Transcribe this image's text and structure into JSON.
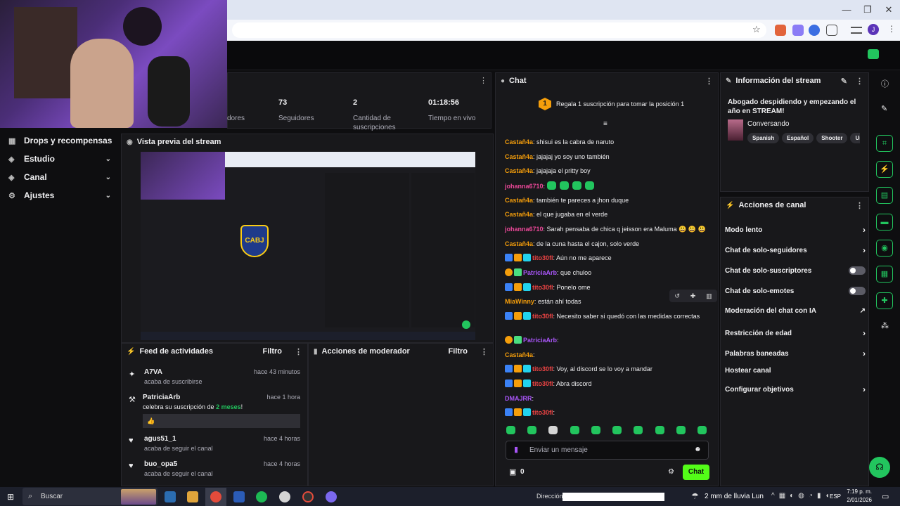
{
  "browser": {
    "window_controls": [
      "—",
      "❐",
      "✕"
    ],
    "profile_initial": "J"
  },
  "nav": {
    "items": [
      {
        "label": "Drops y recompensas",
        "icon": "gift-icon",
        "chevron": false
      },
      {
        "label": "Estudio",
        "icon": "studio-icon",
        "chevron": true
      },
      {
        "label": "Canal",
        "icon": "channel-icon",
        "chevron": true
      },
      {
        "label": "Ajustes",
        "icon": "gear-icon",
        "chevron": true
      }
    ]
  },
  "stats": [
    {
      "value": "",
      "label": "dores"
    },
    {
      "value": "73",
      "label": "Seguidores"
    },
    {
      "value": "2",
      "label": "Cantidad de suscripciones"
    },
    {
      "value": "01:18:56",
      "label": "Tiempo en vivo"
    }
  ],
  "preview": {
    "title": "Vista previa del stream",
    "logo_text": "CABJ"
  },
  "activity": {
    "title": "Feed de actividades",
    "filter": "Filtro",
    "items": [
      {
        "name": "A7VA",
        "sub": "acaba de suscribirse",
        "time": "hace 43 minutos",
        "icon": "sparkle-icon"
      },
      {
        "name": "PatriciaArb",
        "sub_prefix": "celebra su suscripción de ",
        "sub_bold": "2 meses",
        "sub_suffix": "!",
        "time": "hace 1 hora",
        "icon": "resub-icon",
        "message": "👍"
      },
      {
        "name": "agus51_1",
        "sub": "acaba de seguir el canal",
        "time": "hace 4 horas",
        "icon": "heart-icon"
      },
      {
        "name": "buo_opa5",
        "sub": "acaba de seguir el canal",
        "time": "hace 4 horas",
        "icon": "heart-icon"
      }
    ]
  },
  "moderator": {
    "title": "Acciones de moderador",
    "filter": "Filtro"
  },
  "chat": {
    "title": "Chat",
    "banner_rank": "1",
    "banner": "Regala 1 suscripción para tomar la posición 1",
    "messages": [
      {
        "user": "Castañ4a",
        "text": "shisui es la cabra de naruto",
        "color": "#f59e0b"
      },
      {
        "user": "Castañ4a",
        "text": "jajajaj yo soy uno también",
        "color": "#f59e0b"
      },
      {
        "user": "Castañ4a",
        "text": "jajajaja el pritty boy",
        "color": "#f59e0b"
      },
      {
        "user": "johanna6710",
        "text": "",
        "color": "#ec4899",
        "emotes": 4
      },
      {
        "user": "Castañ4a",
        "text": "también te pareces a jhon duque",
        "color": "#f59e0b"
      },
      {
        "user": "Castañ4a",
        "text": "el que jugaba en el verde",
        "color": "#f59e0b"
      },
      {
        "user": "johanna6710",
        "text": "Sarah pensaba de chica q jeisson era Maluma 😃 😃 😃",
        "color": "#ec4899"
      },
      {
        "user": "Castañ4a",
        "text": "de la cuna hasta el cajon, solo verde",
        "color": "#f59e0b"
      },
      {
        "user": "tito30fl",
        "text": "Aún no me aparece",
        "color": "#ef4444",
        "badges": 3
      },
      {
        "user": "PatriciaArb",
        "text": "que chuloo",
        "color": "#a855f7",
        "badges": 2
      },
      {
        "user": "tito30fl",
        "text": "Ponelo ome",
        "color": "#ef4444",
        "badges": 3
      },
      {
        "user": "MiaWinny",
        "text": "están ahí todas",
        "color": "#f59e0b"
      },
      {
        "user": "tito30fl",
        "text": "Necesito saber si quedó con las medidas correctas",
        "color": "#ef4444",
        "badges": 3
      },
      {
        "user": "PatriciaArb",
        "text": "",
        "color": "#a855f7",
        "badges": 2
      },
      {
        "user": "Castañ4a",
        "text": "",
        "color": "#f59e0b"
      },
      {
        "user": "tito30fl",
        "text": "Voy, al discord se lo voy a mandar",
        "color": "#ef4444",
        "badges": 3
      },
      {
        "user": "tito30fl",
        "text": "Abra discord",
        "color": "#ef4444",
        "badges": 3
      },
      {
        "user": "DMAJRR",
        "text": "",
        "color": "#a855f7"
      },
      {
        "user": "tito30fl",
        "text": "",
        "color": "#ef4444",
        "badges": 3
      }
    ],
    "input_placeholder": "Enviar un mensaje",
    "points": "0",
    "send_label": "Chat"
  },
  "stream_info": {
    "title": "Información del stream",
    "stream_title": "Abogado despidiendo y empezando el año en STREAM!",
    "category": "Conversando",
    "tags": [
      "Spanish",
      "Español",
      "Shooter",
      "Una"
    ]
  },
  "channel_actions": {
    "title": "Acciones de canal",
    "items": [
      {
        "label": "Modo lento",
        "control": "chevron"
      },
      {
        "label": "Chat de solo-seguidores",
        "control": "chevron"
      },
      {
        "label": "Chat de solo-suscriptores",
        "control": "toggle"
      },
      {
        "label": "Chat de solo-emotes",
        "control": "toggle"
      },
      {
        "label": "Moderación del chat con IA",
        "control": "external"
      },
      {
        "label": "Restricción de edad",
        "control": "chevron"
      },
      {
        "label": "Palabras baneadas",
        "control": "chevron"
      },
      {
        "label": "Hostear canal",
        "control": "none"
      },
      {
        "label": "Configurar objetivos",
        "control": "chevron"
      }
    ]
  },
  "taskbar": {
    "search": "Buscar",
    "address_label": "Dirección",
    "weather": "2 mm de lluvia Lun",
    "lang": "ESP",
    "time": "7:19 p. m.",
    "date": "2/01/2026"
  },
  "colors": {
    "accent": "#53fc18",
    "panel": "#18181b",
    "bg": "#0e0e10"
  }
}
